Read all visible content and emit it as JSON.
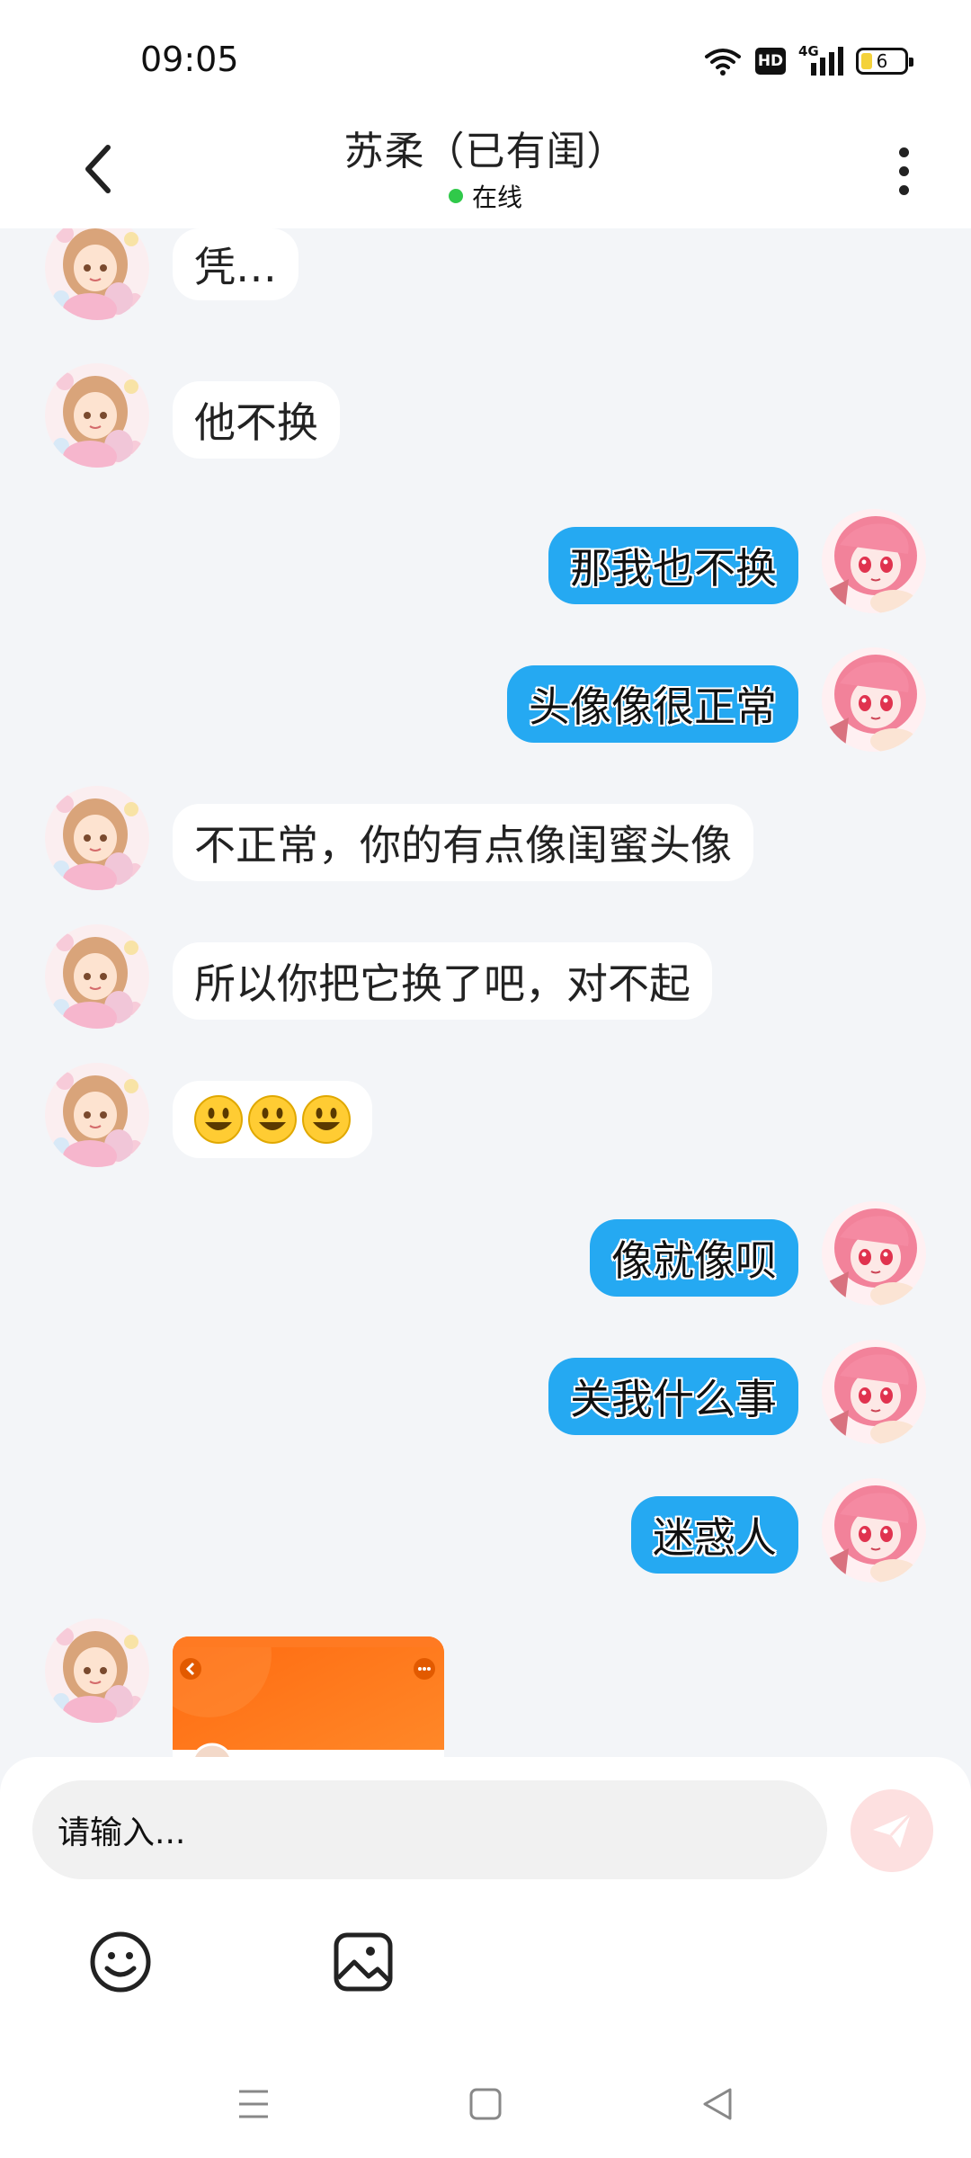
{
  "status_bar": {
    "time": "09:05",
    "hd_label": "HD",
    "network_label": "4G",
    "battery_level": "6"
  },
  "header": {
    "title": "苏柔（已有闺）",
    "status_text": "在线"
  },
  "messages": [
    {
      "side": "left",
      "text": "凭…"
    },
    {
      "side": "left",
      "text": "他不换"
    },
    {
      "side": "right",
      "text": "那我也不换"
    },
    {
      "side": "right",
      "text": "头像像很正常"
    },
    {
      "side": "left",
      "text": "不正常，你的有点像闺蜜头像"
    },
    {
      "side": "left",
      "text": "所以你把它换了吧，对不起"
    },
    {
      "side": "left",
      "type": "emoji",
      "emojis": [
        "smiley",
        "smiley",
        "smiley"
      ]
    },
    {
      "side": "right",
      "text": "像就像呗"
    },
    {
      "side": "right",
      "text": "关我什么事"
    },
    {
      "side": "right",
      "text": "迷惑人"
    },
    {
      "side": "left",
      "type": "image",
      "image_caption": "screenshot"
    }
  ],
  "composer": {
    "placeholder": "请输入..."
  },
  "icons": {
    "back": "chevron-left-icon",
    "more": "more-vertical-icon",
    "send": "send-icon",
    "emoji": "emoji-icon",
    "image": "image-icon",
    "nav_menu": "menu-icon",
    "nav_home": "square-icon",
    "nav_back": "triangle-back-icon"
  },
  "colors": {
    "sent_bubble": "#25a9f2",
    "received_bubble": "#ffffff",
    "online_dot": "#30c94a",
    "chat_bg": "#f3f5f8"
  }
}
